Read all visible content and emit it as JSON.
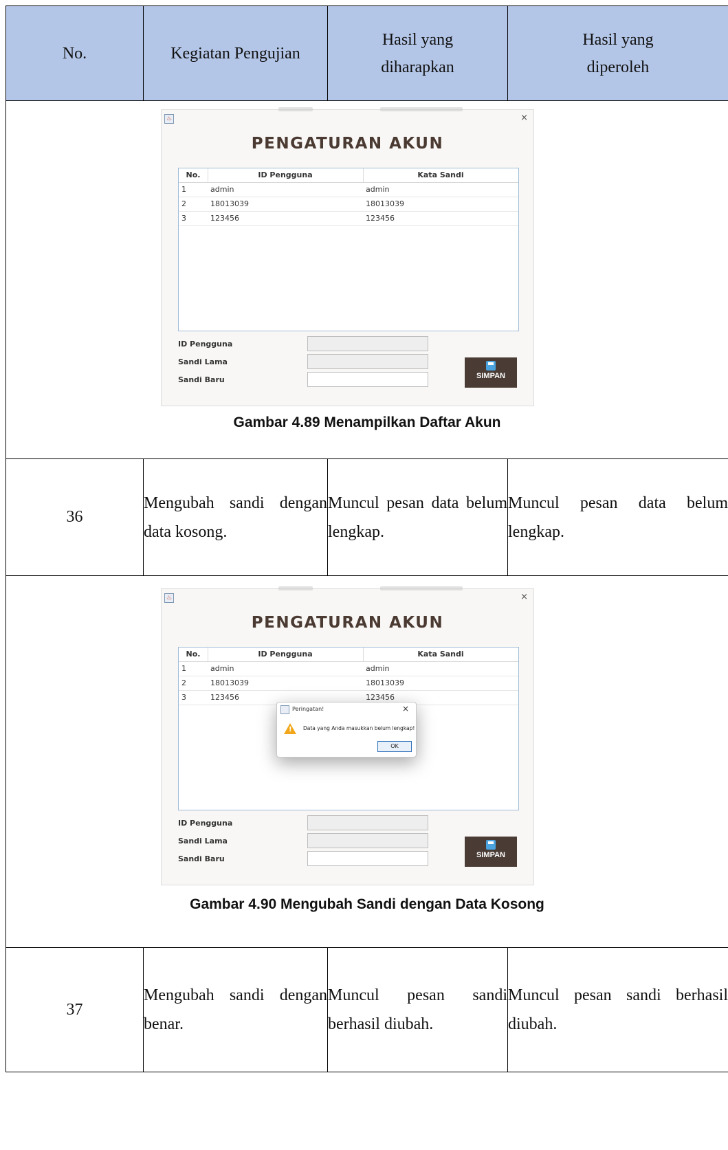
{
  "table": {
    "headers": [
      "No.",
      "Kegiatan Pengujian",
      "Hasil yang diharapkan",
      "Hasil yang diperoleh"
    ],
    "rows": [
      {
        "no": "36",
        "kegiatan": "Mengubah sandi dengan data kosong.",
        "diharapkan": "Muncul pesan data belum lengkap.",
        "diperoleh": "Muncul pesan data belum lengkap."
      },
      {
        "no": "37",
        "kegiatan": "Mengubah sandi dengan benar.",
        "diharapkan": "Muncul pesan sandi berhasil diubah.",
        "diperoleh": "Muncul pesan sandi berhasil diubah."
      }
    ]
  },
  "figures": [
    {
      "caption": "Gambar 4.89 Menampilkan Daftar Akun"
    },
    {
      "caption": "Gambar 4.90 Mengubah Sandi dengan Data Kosong"
    }
  ],
  "app": {
    "title": "PENGATURAN AKUN",
    "columns": [
      "No.",
      "ID Pengguna",
      "Kata Sandi"
    ],
    "accounts": [
      {
        "no": "1",
        "id": "admin",
        "sandi": "admin"
      },
      {
        "no": "2",
        "id": "18013039",
        "sandi": "18013039"
      },
      {
        "no": "3",
        "id": "123456",
        "sandi": "123456"
      }
    ],
    "labels": {
      "id": "ID Pengguna",
      "lama": "Sandi Lama",
      "baru": "Sandi Baru"
    },
    "save_label": "SIMPAN",
    "close_glyph": "×"
  },
  "dialog": {
    "title": "Peringatan!",
    "message": "Data yang Anda masukkan belum lengkap!",
    "ok_label": "OK",
    "close_glyph": "×"
  }
}
